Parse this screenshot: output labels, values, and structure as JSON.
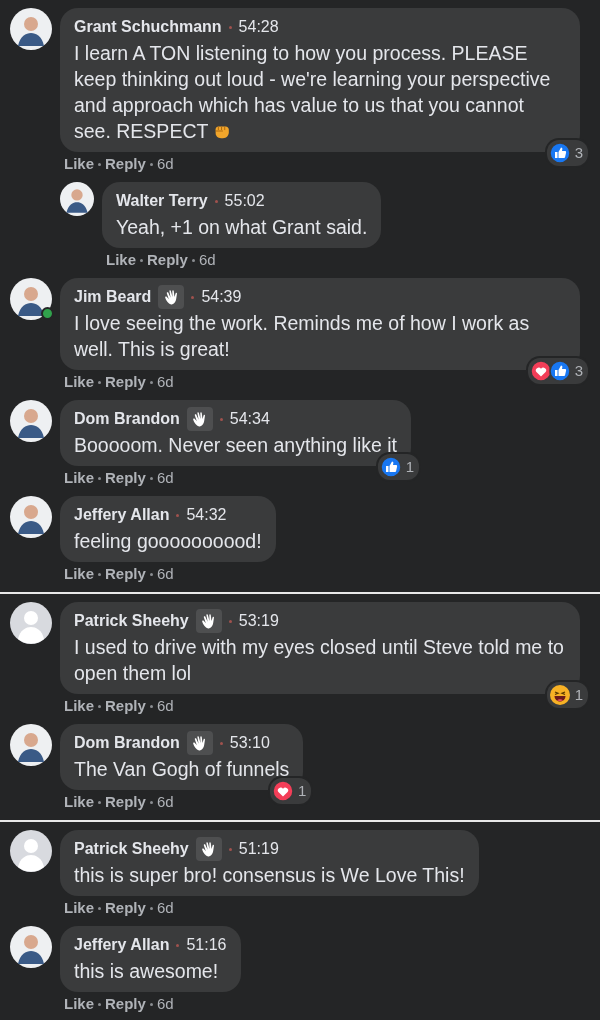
{
  "panels": [
    {
      "comments": [
        {
          "has_photo": true,
          "online": false,
          "author": "Grant Schuchmann",
          "badge": false,
          "time": "54:28",
          "text": "I learn A TON listening to how you process. PLEASE keep thinking out loud - we're learning your perspective and approach which has value to us that you cannot see. RESPECT",
          "has_emoji": true,
          "reactions": [
            {
              "kind": "like"
            }
          ],
          "reaction_count": "3",
          "actions": {
            "like": "Like",
            "reply": "Reply",
            "age": "6d"
          },
          "children": [
            {
              "has_photo": true,
              "online": false,
              "author": "Walter Terry",
              "badge": false,
              "time": "55:02",
              "text": "Yeah, +1 on what Grant said.",
              "has_emoji": false,
              "actions": {
                "like": "Like",
                "reply": "Reply",
                "age": "6d"
              }
            }
          ]
        },
        {
          "has_photo": true,
          "online": true,
          "author": "Jim Beard",
          "badge": true,
          "time": "54:39",
          "text": "I love seeing the work. Reminds me of how I work as well. This is great!",
          "has_emoji": false,
          "reactions": [
            {
              "kind": "love"
            },
            {
              "kind": "like"
            }
          ],
          "reaction_count": "3",
          "actions": {
            "like": "Like",
            "reply": "Reply",
            "age": "6d"
          }
        },
        {
          "has_photo": true,
          "online": false,
          "author": "Dom Brandon",
          "badge": true,
          "time": "54:34",
          "text": "Booooom. Never seen anything like it",
          "has_emoji": false,
          "reactions": [
            {
              "kind": "like"
            }
          ],
          "reaction_count": "1",
          "actions": {
            "like": "Like",
            "reply": "Reply",
            "age": "6d"
          }
        },
        {
          "has_photo": true,
          "online": false,
          "author": "Jeffery Allan",
          "badge": false,
          "time": "54:32",
          "text": "feeling goooooooood!",
          "has_emoji": false,
          "actions": {
            "like": "Like",
            "reply": "Reply",
            "age": "6d"
          }
        }
      ]
    },
    {
      "comments": [
        {
          "has_photo": false,
          "online": false,
          "author": "Patrick Sheehy",
          "badge": true,
          "time": "53:19",
          "text": "I used to drive with my eyes closed until Steve told me to open them lol",
          "has_emoji": false,
          "reactions": [
            {
              "kind": "haha"
            }
          ],
          "reaction_count": "1",
          "actions": {
            "like": "Like",
            "reply": "Reply",
            "age": "6d"
          }
        },
        {
          "has_photo": true,
          "online": false,
          "author": "Dom Brandon",
          "badge": true,
          "time": "53:10",
          "text": "The Van Gogh of funnels",
          "has_emoji": false,
          "reactions": [
            {
              "kind": "love"
            }
          ],
          "reaction_count": "1",
          "actions": {
            "like": "Like",
            "reply": "Reply",
            "age": "6d"
          }
        }
      ]
    },
    {
      "comments": [
        {
          "has_photo": false,
          "online": false,
          "author": "Patrick Sheehy",
          "badge": true,
          "time": "51:19",
          "text": "this is super bro! consensus is We Love This!",
          "has_emoji": false,
          "actions": {
            "like": "Like",
            "reply": "Reply",
            "age": "6d"
          }
        },
        {
          "has_photo": true,
          "online": false,
          "author": "Jeffery Allan",
          "badge": false,
          "time": "51:16",
          "text": "this is awesome!",
          "has_emoji": false,
          "actions": {
            "like": "Like",
            "reply": "Reply",
            "age": "6d"
          }
        }
      ]
    }
  ]
}
